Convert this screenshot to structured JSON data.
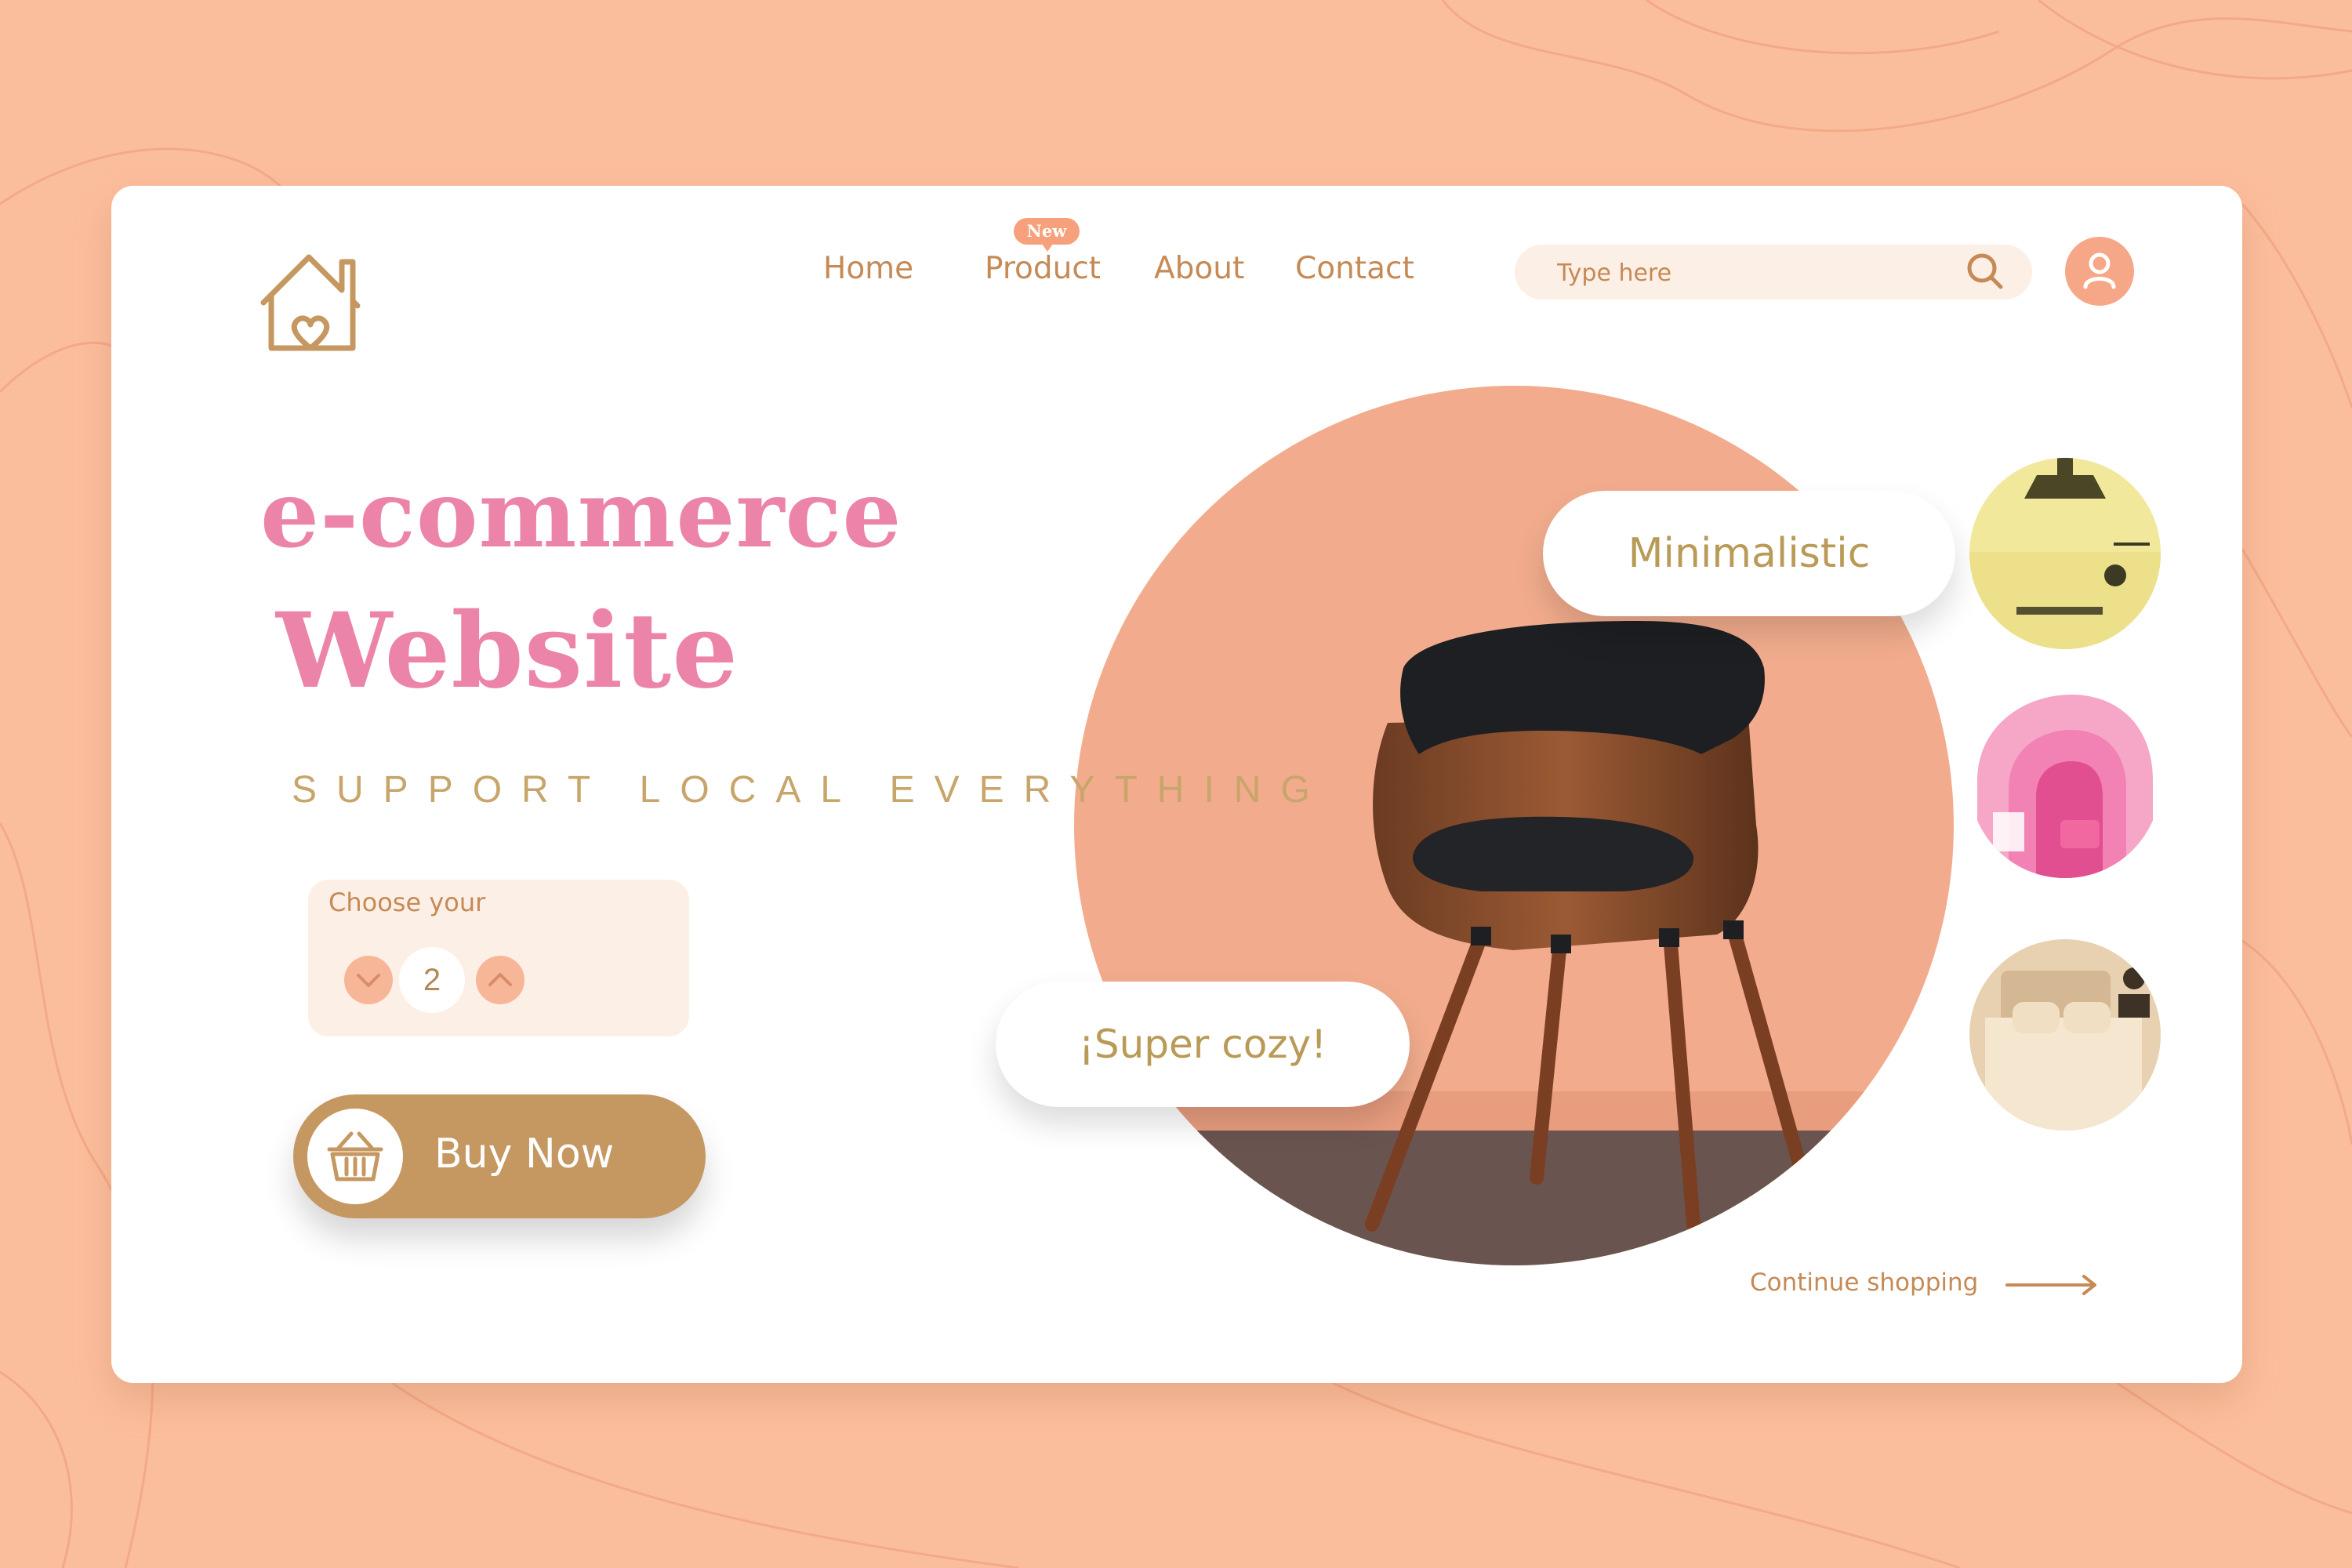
{
  "nav": {
    "items": [
      {
        "label": "Home"
      },
      {
        "label": "Product",
        "badge": "New"
      },
      {
        "label": "About"
      },
      {
        "label": "Contact"
      }
    ]
  },
  "search": {
    "placeholder": "Type here"
  },
  "hero": {
    "headline_line1": "e-commerce",
    "headline_line2": "Website",
    "tagline": "SUPPORT LOCAL EVERYTHING"
  },
  "chooser": {
    "label": "Choose your",
    "quantity": "2"
  },
  "buy_button": {
    "label": "Buy Now"
  },
  "product_tags": {
    "minimal": "Minimalistic",
    "cozy": "¡Super cozy!"
  },
  "continue_link": {
    "label": "Continue shopping"
  },
  "colors": {
    "background": "#fbbe9c",
    "accent": "#c69861",
    "headline": "#ec84a9",
    "text": "#c58a55",
    "hero_circle": "#f2ac8d"
  },
  "icons": [
    "house-heart-logo-icon",
    "search-icon",
    "user-icon",
    "chevron-down-icon",
    "chevron-up-icon",
    "basket-icon",
    "arrow-right-icon"
  ]
}
